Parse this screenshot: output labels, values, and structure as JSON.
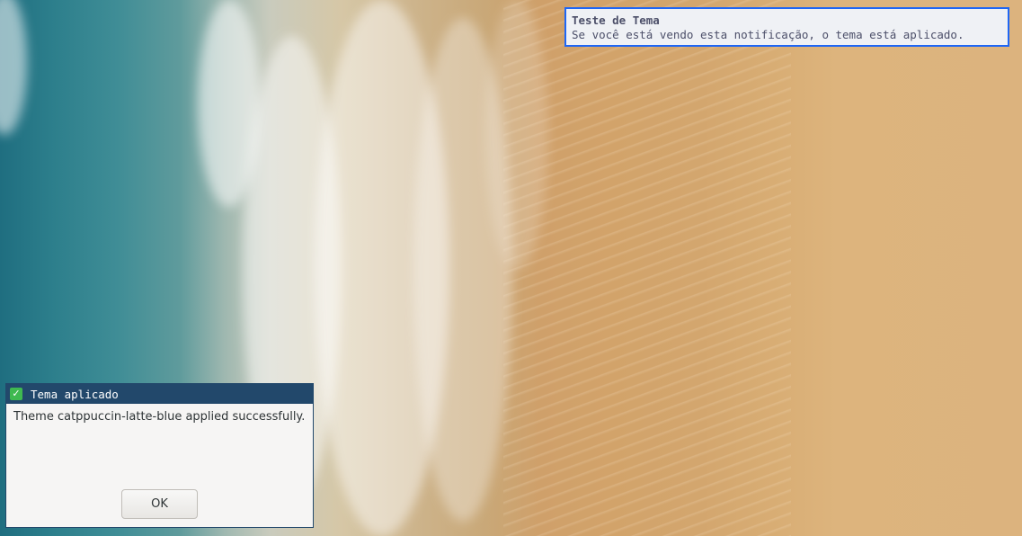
{
  "notification": {
    "summary": "Teste de Tema",
    "body": "Se você está vendo esta notificação, o tema está aplicado.",
    "border_color": "#1e66f5",
    "background": "#eff1f5"
  },
  "dialog": {
    "title": "Tema aplicado",
    "title_icon": "check-mark-icon",
    "message": "Theme catppuccin-latte-blue applied successfully.",
    "ok_label": "OK",
    "titlebar_color": "#22486b"
  }
}
